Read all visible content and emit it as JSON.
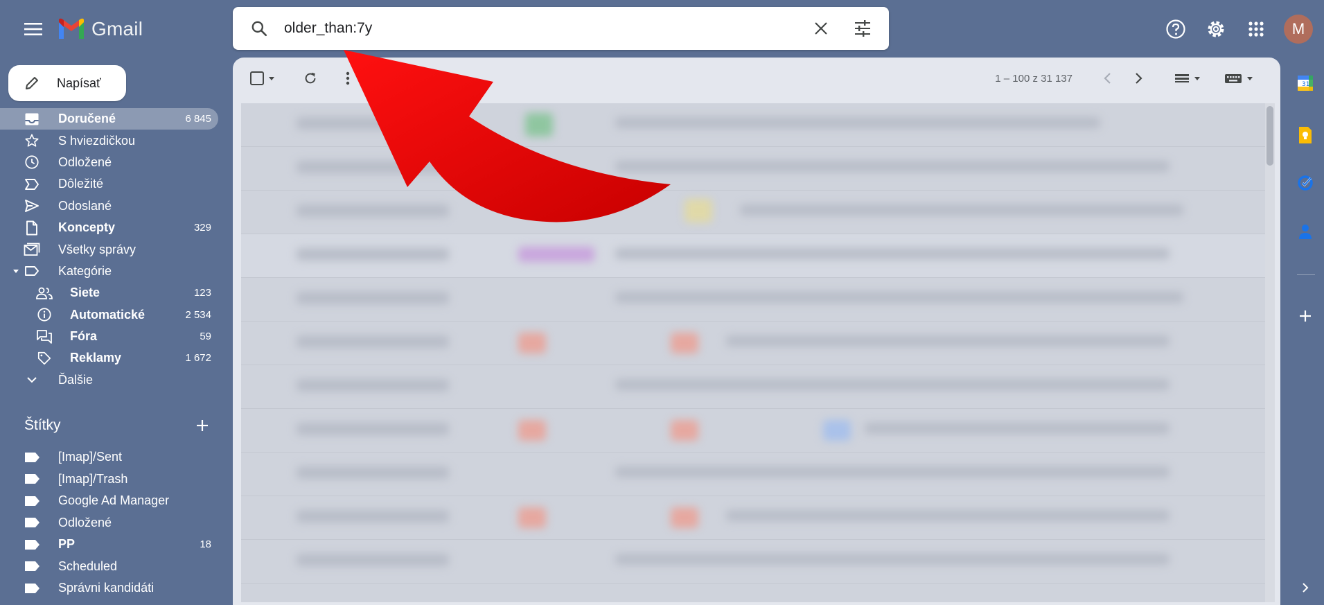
{
  "app": {
    "logo_text": "Gmail"
  },
  "search": {
    "value": "older_than:7y"
  },
  "compose": {
    "label": "Napísať"
  },
  "nav": [
    {
      "label": "Doručené",
      "count": "6 845",
      "icon": "inbox-icon",
      "bold": true,
      "active": true
    },
    {
      "label": "S hviezdičkou",
      "count": "",
      "icon": "star-icon"
    },
    {
      "label": "Odložené",
      "count": "",
      "icon": "clock-icon"
    },
    {
      "label": "Dôležité",
      "count": "",
      "icon": "important-icon"
    },
    {
      "label": "Odoslané",
      "count": "",
      "icon": "send-icon"
    },
    {
      "label": "Koncepty",
      "count": "329",
      "icon": "draft-icon",
      "bold": true
    },
    {
      "label": "Všetky správy",
      "count": "",
      "icon": "all-mail-icon"
    },
    {
      "label": "Kategórie",
      "count": "",
      "icon": "label-outline-icon",
      "caret": true
    },
    {
      "label": "Siete",
      "count": "123",
      "icon": "people-icon",
      "bold": true,
      "sub": true
    },
    {
      "label": "Automatické",
      "count": "2 534",
      "icon": "info-icon",
      "bold": true,
      "sub": true
    },
    {
      "label": "Fóra",
      "count": "59",
      "icon": "forum-icon",
      "bold": true,
      "sub": true
    },
    {
      "label": "Reklamy",
      "count": "1 672",
      "icon": "tag-icon",
      "bold": true,
      "sub": true
    },
    {
      "label": "Ďalšie",
      "count": "",
      "icon": "chevron-down-icon"
    }
  ],
  "labels_section": {
    "title": "Štítky",
    "items": [
      {
        "label": "[Imap]/Sent",
        "count": ""
      },
      {
        "label": "[Imap]/Trash",
        "count": ""
      },
      {
        "label": "Google Ad Manager",
        "count": ""
      },
      {
        "label": "Odložené",
        "count": ""
      },
      {
        "label": "PP",
        "count": "18",
        "bold": true
      },
      {
        "label": "Scheduled",
        "count": ""
      },
      {
        "label": "Správni kandidáti",
        "count": ""
      }
    ]
  },
  "toolbar": {
    "pager_text": "1 – 100 z 31 137"
  },
  "top_right": {
    "avatar_letter": "M"
  },
  "colors": {
    "background": "#5b6f93",
    "arrow": "#e00000",
    "avatar": "#b06d5c"
  }
}
